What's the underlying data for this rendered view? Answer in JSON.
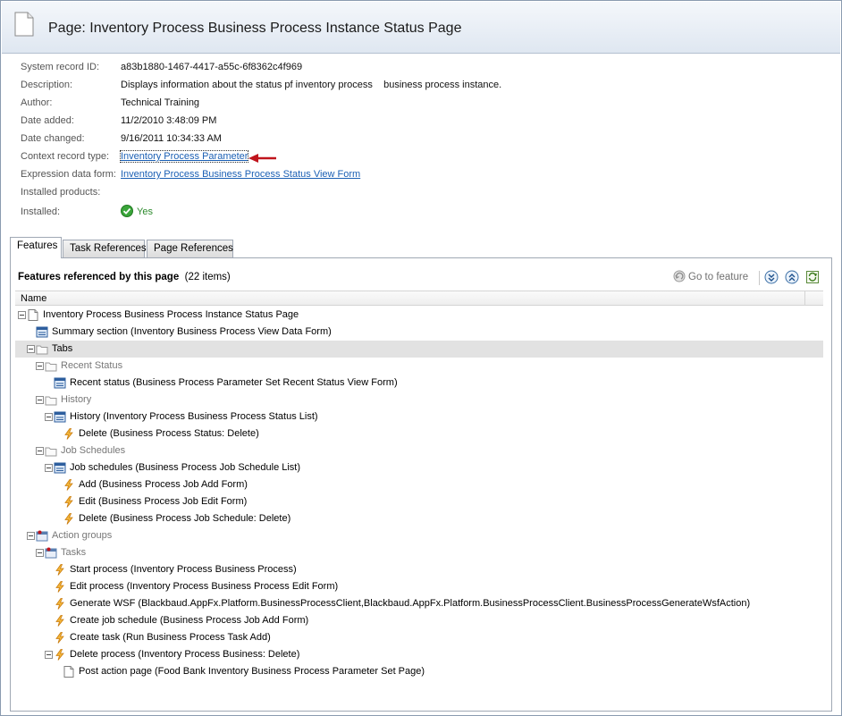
{
  "header": {
    "title": "Page:  Inventory Process Business Process Instance Status Page",
    "icon": "page-icon"
  },
  "properties": [
    {
      "label": "System record ID:",
      "value": "a83b1880-1467-4417-a55c-6f8362c4f969"
    },
    {
      "label": "Description:",
      "value": "Displays information about the status pf inventory process    business process instance."
    },
    {
      "label": "Author:",
      "value": "Technical Training"
    },
    {
      "label": "Date added:",
      "value": "11/2/2010 3:48:09 PM"
    },
    {
      "label": "Date changed:",
      "value": "9/16/2011 10:34:33 AM"
    },
    {
      "label": "Context record type:",
      "value": "Inventory Process Parameter"
    },
    {
      "label": "Expression data form:",
      "value": "Inventory Process Business Process Status View Form"
    },
    {
      "label": "Installed products:",
      "value": ""
    },
    {
      "label": "Installed:",
      "value": "Yes"
    }
  ],
  "tabs": [
    "Features",
    "Task References",
    "Page References"
  ],
  "features": {
    "title": "Features referenced by this page",
    "count": "(22 items)",
    "goto_label": "Go to feature",
    "column_name": "Name",
    "rows": [
      {
        "label": "Inventory Process Business Process Instance Status Page",
        "icon": "page-icon"
      },
      {
        "label": "Summary section (Inventory Business Process View Data Form)",
        "icon": "form-icon"
      },
      {
        "label": "Tabs",
        "icon": "folder-icon"
      },
      {
        "label": "Recent Status",
        "icon": "folder-icon"
      },
      {
        "label": "Recent status (Business Process Parameter Set Recent Status View Form)",
        "icon": "form-icon"
      },
      {
        "label": "History",
        "icon": "folder-icon"
      },
      {
        "label": "History (Inventory Process Business Process Status List)",
        "icon": "form-icon"
      },
      {
        "label": "Delete (Business Process Status: Delete)",
        "icon": "lightning-icon"
      },
      {
        "label": "Job Schedules",
        "icon": "folder-icon"
      },
      {
        "label": "Job schedules (Business Process Job Schedule List)",
        "icon": "form-icon"
      },
      {
        "label": "Add (Business Process Job Add Form)",
        "icon": "lightning-icon"
      },
      {
        "label": "Edit (Business Process Job Edit Form)",
        "icon": "lightning-icon"
      },
      {
        "label": "Delete (Business Process Job Schedule: Delete)",
        "icon": "lightning-icon"
      },
      {
        "label": "Action groups",
        "icon": "action-group-icon"
      },
      {
        "label": "Tasks",
        "icon": "action-group-icon"
      },
      {
        "label": "Start process (Inventory Process Business Process)",
        "icon": "lightning-icon"
      },
      {
        "label": "Edit process (Inventory Process Business Process Edit Form)",
        "icon": "lightning-icon"
      },
      {
        "label": "Generate WSF (Blackbaud.AppFx.Platform.BusinessProcessClient,Blackbaud.AppFx.Platform.BusinessProcessClient.BusinessProcessGenerateWsfAction)",
        "icon": "lightning-icon"
      },
      {
        "label": "Create job schedule (Business Process Job Add Form)",
        "icon": "lightning-icon"
      },
      {
        "label": "Create task (Run Business Process Task Add)",
        "icon": "lightning-icon"
      },
      {
        "label": "Delete process (Inventory Process Business: Delete)",
        "icon": "lightning-icon"
      },
      {
        "label": "Post action page (Food Bank Inventory Business Process Parameter Set Page)",
        "icon": "page-icon"
      }
    ]
  },
  "colors": {
    "link": "#1a5fb4",
    "arrow": "#c0141c",
    "yes": "#2d8a2d",
    "selected_row": "#e2e2e2"
  }
}
